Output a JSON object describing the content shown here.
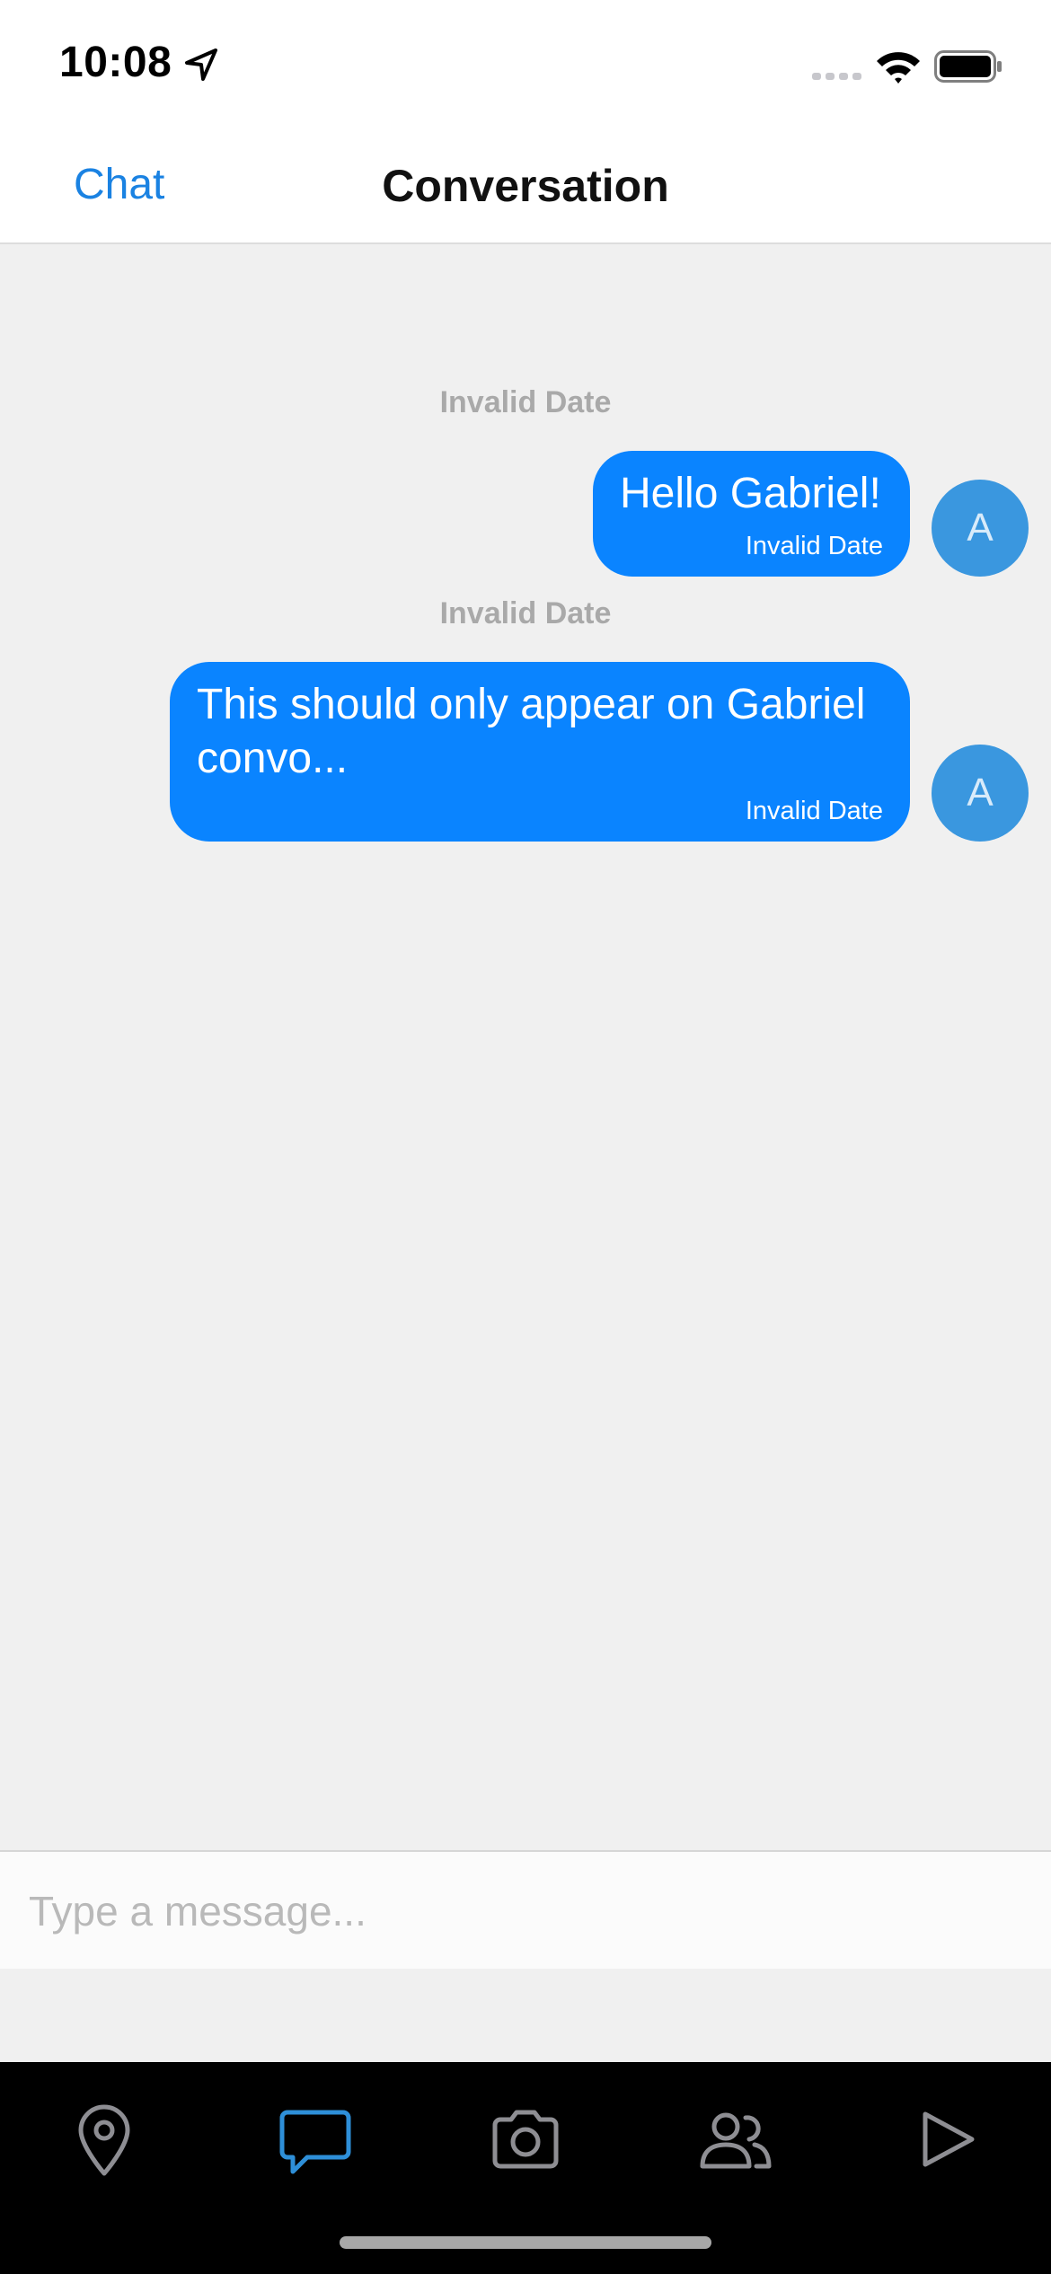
{
  "status_bar": {
    "time": "10:08",
    "icons": [
      "location-arrow-icon",
      "signal-icon",
      "wifi-icon",
      "battery-icon"
    ]
  },
  "nav": {
    "back_label": "Chat",
    "title": "Conversation"
  },
  "messages": [
    {
      "date_separator": "Invalid Date",
      "text": "Hello Gabriel!",
      "timestamp": "Invalid Date",
      "avatar_initial": "A"
    },
    {
      "date_separator": "Invalid Date",
      "text": "This should only appear on Gabriel convo...",
      "timestamp": "Invalid Date",
      "avatar_initial": "A"
    }
  ],
  "composer": {
    "placeholder": "Type a message..."
  },
  "tab_bar": {
    "tabs": [
      {
        "icon": "map-pin-icon",
        "active": false
      },
      {
        "icon": "chat-bubble-icon",
        "active": true
      },
      {
        "icon": "camera-icon",
        "active": false
      },
      {
        "icon": "people-icon",
        "active": false
      },
      {
        "icon": "play-icon",
        "active": false
      }
    ]
  },
  "colors": {
    "accent": "#1a82e2",
    "bubble": "#0a84ff",
    "avatar": "#3a97df",
    "tab_active": "#2e8fd8",
    "tab_inactive": "#8e8e93"
  }
}
